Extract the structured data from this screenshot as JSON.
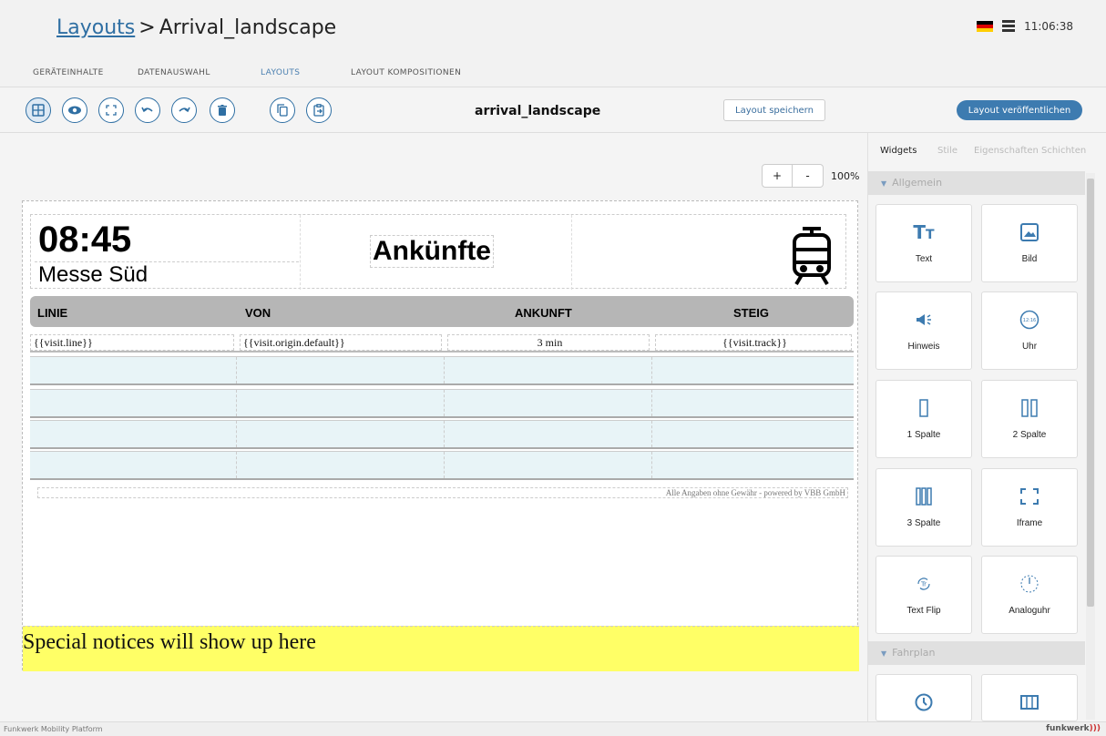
{
  "header": {
    "crumb_link": "Layouts",
    "crumb_sep": ">",
    "crumb_current": "Arrival_landscape",
    "time": "11:06:38",
    "flag_colors": [
      "#000000",
      "#dd0000",
      "#ffce00"
    ]
  },
  "tabs": [
    {
      "label": "GERÄTEINHALTE"
    },
    {
      "label": "DATENAUSWAHL"
    },
    {
      "label": "LAYOUTS"
    },
    {
      "label": "LAYOUT KOMPOSITIONEN"
    }
  ],
  "toolbar": {
    "layout_name": "arrival_landscape",
    "save_label": "Layout speichern",
    "publish_label": "Layout veröffentlichen",
    "icons": [
      "grid-icon",
      "eye-icon",
      "fullscreen-icon",
      "undo-icon",
      "redo-icon",
      "trash-icon",
      "copy-icon",
      "paste-icon"
    ]
  },
  "zoom": {
    "plus": "+",
    "minus": "-",
    "level": "100%"
  },
  "layout": {
    "time": "08:45",
    "stop": "Messe Süd",
    "title": "Ankünfte",
    "table_headers": [
      "LINIE",
      "VON",
      "ANKUNFT",
      "STEIG"
    ],
    "template_row": [
      "{{visit.line}}",
      "{{visit.origin.default}}",
      "3 min",
      "{{visit.track}}"
    ],
    "disclaimer": "Alle Angaben ohne Gewähr - powered by VBB GmbH",
    "notice": "Special notices will show up here",
    "notice_color": "#ffff66",
    "header_bg": "#b6b6b6"
  },
  "panel": {
    "tabs": [
      "Widgets",
      "Stile",
      "Eigenschaften",
      "Schichten"
    ],
    "section_general": "Allgemein",
    "section_schedule": "Fahrplan",
    "widgets": [
      {
        "label": "Text",
        "icon": "text-icon"
      },
      {
        "label": "Bild",
        "icon": "image-icon"
      },
      {
        "label": "Hinweis",
        "icon": "megaphone-icon"
      },
      {
        "label": "Uhr",
        "icon": "clock-icon"
      },
      {
        "label": "1 Spalte",
        "icon": "one-column-icon"
      },
      {
        "label": "2 Spalte",
        "icon": "two-column-icon"
      },
      {
        "label": "3 Spalte",
        "icon": "three-column-icon"
      },
      {
        "label": "Iframe",
        "icon": "iframe-icon"
      },
      {
        "label": "Text Flip",
        "icon": "text-flip-icon"
      },
      {
        "label": "Analoguhr",
        "icon": "analog-clock-icon"
      }
    ],
    "accent": "#3d7bb0"
  },
  "status": {
    "left": "Funkwerk Mobility Platform",
    "brand": "funkwerk",
    "brand_mark": ")))"
  }
}
